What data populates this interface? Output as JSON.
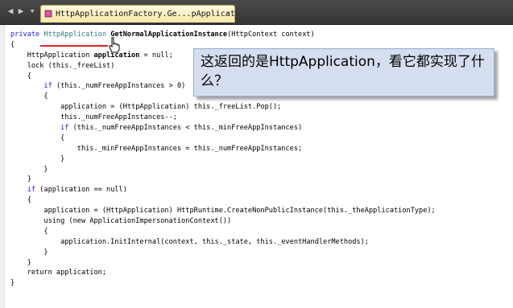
{
  "tab": {
    "title": "HttpApplicationFactory.Ge...pApplication"
  },
  "code": {
    "lines": [
      [
        {
          "t": "private ",
          "c": "kw"
        },
        {
          "t": "HttpApplication ",
          "c": "ty"
        },
        {
          "t": "GetNormalApplicationInstance",
          "c": "b"
        },
        {
          "t": "(HttpContext context)"
        }
      ],
      [
        {
          "t": "{"
        }
      ],
      [
        {
          "t": "    HttpApplication "
        },
        {
          "t": "application",
          "c": "b"
        },
        {
          "t": " = null;"
        }
      ],
      [
        {
          "t": "    lock (this._freeList)"
        }
      ],
      [
        {
          "t": "    {"
        }
      ],
      [
        {
          "t": "        "
        },
        {
          "t": "if",
          "c": "kw"
        },
        {
          "t": " (this._numFreeAppInstances > 0)"
        }
      ],
      [
        {
          "t": "        {"
        }
      ],
      [
        {
          "t": "            application = (HttpApplication) this._freeList.Pop();"
        }
      ],
      [
        {
          "t": "            this._numFreeAppInstances--;"
        }
      ],
      [
        {
          "t": "            "
        },
        {
          "t": "if",
          "c": "kw"
        },
        {
          "t": " (this._numFreeAppInstances < this._minFreeAppInstances)"
        }
      ],
      [
        {
          "t": "            {"
        }
      ],
      [
        {
          "t": "                this._minFreeAppInstances = this._numFreeAppInstances;"
        }
      ],
      [
        {
          "t": "            }"
        }
      ],
      [
        {
          "t": "        }"
        }
      ],
      [
        {
          "t": "    }"
        }
      ],
      [
        {
          "t": "    "
        },
        {
          "t": "if",
          "c": "kw"
        },
        {
          "t": " (application == null)"
        }
      ],
      [
        {
          "t": "    {"
        }
      ],
      [
        {
          "t": "        application = (HttpApplication) HttpRuntime.CreateNonPublicInstance(this._theApplicationType);"
        }
      ],
      [
        {
          "t": "        using (new ApplicationImpersonationContext())"
        }
      ],
      [
        {
          "t": "        {"
        }
      ],
      [
        {
          "t": "            application.InitInternal(context, this._state, this._eventHandlerMethods);"
        }
      ],
      [
        {
          "t": "        }"
        }
      ],
      [
        {
          "t": "    }"
        }
      ],
      [
        {
          "t": "    return application;"
        }
      ],
      [
        {
          "t": "}"
        }
      ]
    ]
  },
  "callout": {
    "text": "这返回的是HttpApplication，看它都实现了什么？"
  },
  "colors": {
    "keyword": "#1a1ae6",
    "type": "#2b7a8a",
    "annotation": "#e02020",
    "callout_bg": "#d4def0",
    "tab_bg": "#f7e7a6"
  }
}
